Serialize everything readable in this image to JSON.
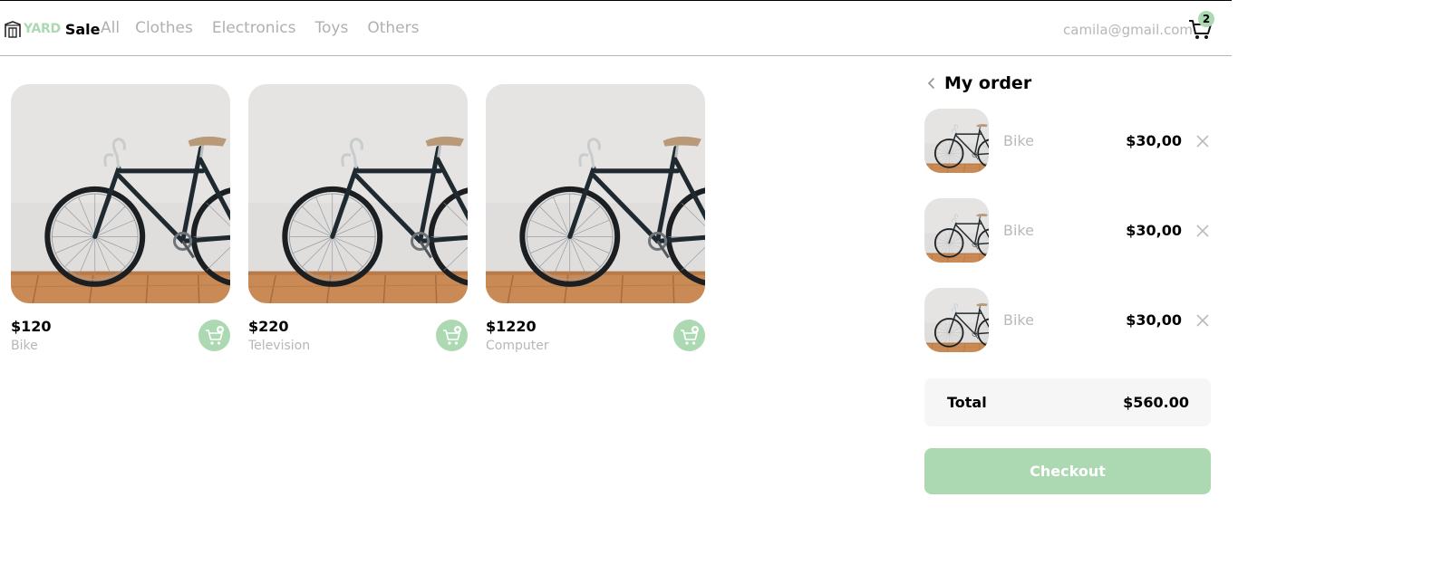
{
  "nav": {
    "logo_yard": "YARD",
    "logo_sale": "Sale",
    "links": [
      "All",
      "Clothes",
      "Electronics",
      "Toys",
      "Others"
    ],
    "user_email": "camila@gmail.com",
    "cart_count": "2"
  },
  "colors": {
    "accent": "#acd9b2",
    "muted_text": "#b7b7b7",
    "panel_bg": "#f6f6f6"
  },
  "products": [
    {
      "price": "$120",
      "name": "Bike",
      "image": "bicycle-photo"
    },
    {
      "price": "$220",
      "name": "Television",
      "image": "bicycle-photo"
    },
    {
      "price": "$1220",
      "name": "Computer",
      "image": "bicycle-photo"
    }
  ],
  "order": {
    "title": "My order",
    "items": [
      {
        "name": "Bike",
        "price": "$30,00",
        "image": "bicycle-photo"
      },
      {
        "name": "Bike",
        "price": "$30,00",
        "image": "bicycle-photo"
      },
      {
        "name": "Bike",
        "price": "$30,00",
        "image": "bicycle-photo"
      }
    ],
    "total_label": "Total",
    "total_value": "$560.00",
    "checkout_label": "Checkout"
  },
  "icons": {
    "logo": "storefront-icon",
    "cart": "shopping-cart-icon",
    "add_to_cart": "add-to-cart-icon",
    "back": "chevron-left-icon",
    "remove": "close-icon"
  }
}
